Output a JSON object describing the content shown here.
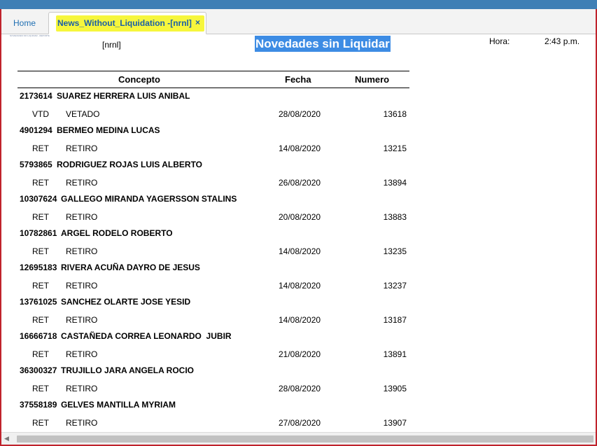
{
  "tabs": {
    "home_label": "Home",
    "report_label": "News_Without_Liquidation -[nrnl]",
    "close_glyph": "×"
  },
  "report": {
    "tiny_header": "NOVEDADES SIN LIQUIDAR - REPORTE",
    "code": "[nrnl]",
    "title": "Novedades sin Liquidar",
    "hora_label": "Hora:",
    "hora_value": "2:43 p.m."
  },
  "columns": {
    "concepto": "Concepto",
    "fecha": "Fecha",
    "numero": "Numero"
  },
  "records": [
    {
      "id": "2173614",
      "name": "SUAREZ HERRERA LUIS ANIBAL",
      "code": "VTD",
      "desc": "VETADO",
      "fecha": "28/08/2020",
      "numero": "13618"
    },
    {
      "id": "4901294",
      "name": "BERMEO MEDINA LUCAS",
      "code": "RET",
      "desc": "RETIRO",
      "fecha": "14/08/2020",
      "numero": "13215"
    },
    {
      "id": "5793865",
      "name": "RODRIGUEZ ROJAS LUIS ALBERTO",
      "code": "RET",
      "desc": "RETIRO",
      "fecha": "26/08/2020",
      "numero": "13894"
    },
    {
      "id": "10307624",
      "name": "GALLEGO MIRANDA YAGERSSON STALINS",
      "code": "RET",
      "desc": "RETIRO",
      "fecha": "20/08/2020",
      "numero": "13883"
    },
    {
      "id": "10782861",
      "name": "ARGEL RODELO ROBERTO",
      "code": "RET",
      "desc": "RETIRO",
      "fecha": "14/08/2020",
      "numero": "13235"
    },
    {
      "id": "12695183",
      "name": "RIVERA ACUÑA DAYRO DE JESUS",
      "code": "RET",
      "desc": "RETIRO",
      "fecha": "14/08/2020",
      "numero": "13237"
    },
    {
      "id": "13761025",
      "name": "SANCHEZ OLARTE JOSE YESID",
      "code": "RET",
      "desc": "RETIRO",
      "fecha": "14/08/2020",
      "numero": "13187"
    },
    {
      "id": "16666718",
      "name": "CASTAÑEDA CORREA LEONARDO  JUBIR",
      "code": "RET",
      "desc": "RETIRO",
      "fecha": "21/08/2020",
      "numero": "13891"
    },
    {
      "id": "36300327",
      "name": "TRUJILLO JARA ANGELA ROCIO",
      "code": "RET",
      "desc": "RETIRO",
      "fecha": "28/08/2020",
      "numero": "13905"
    },
    {
      "id": "37558189",
      "name": "GELVES MANTILLA MYRIAM",
      "code": "RET",
      "desc": "RETIRO",
      "fecha": "27/08/2020",
      "numero": "13907"
    }
  ],
  "scrollbar": {
    "left_arrow": "◀"
  }
}
